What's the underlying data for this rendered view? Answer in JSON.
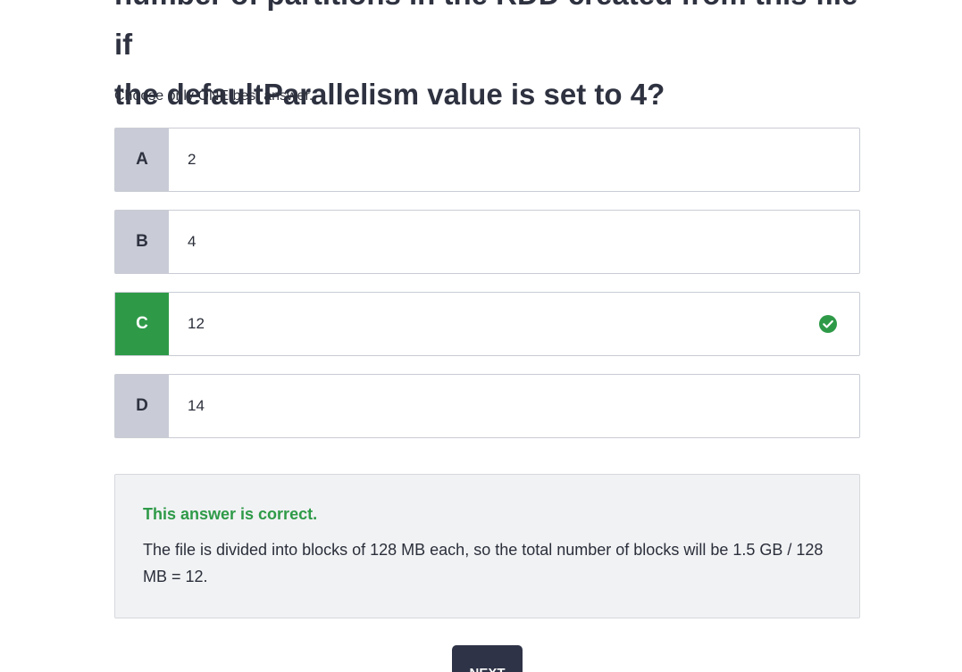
{
  "question": {
    "line1": "number of partitions in the RDD created from this file if",
    "line2": "the defaultParallelism value is set to 4?"
  },
  "instruction": "Choose only ONE best answer.",
  "options": [
    {
      "letter": "A",
      "text": "2",
      "state": "default"
    },
    {
      "letter": "B",
      "text": "4",
      "state": "default"
    },
    {
      "letter": "C",
      "text": "12",
      "state": "correct"
    },
    {
      "letter": "D",
      "text": "14",
      "state": "default"
    }
  ],
  "feedback": {
    "status": "This answer is correct.",
    "explanation": "The file is divided into blocks of 128 MB each, so the total number of blocks will be 1.5 GB / 128 MB = 12."
  },
  "next_button": "NEXT",
  "icons": {
    "correct_check": "check-circle-icon"
  },
  "colors": {
    "correct_green": "#2e9a48",
    "letter_gray": "#c9ccd6",
    "button_dark": "#2e3347",
    "feedback_bg": "#f1f2f4"
  }
}
